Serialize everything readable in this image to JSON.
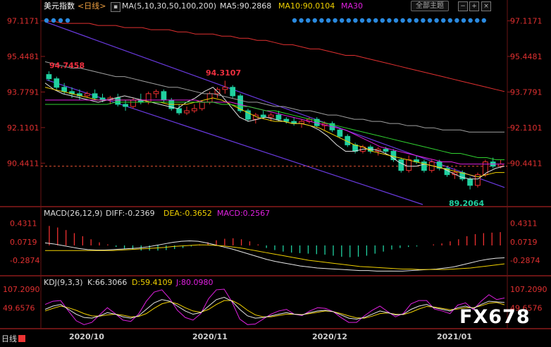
{
  "header": {
    "main_title": "美元指数",
    "period": "<日线>",
    "ma_set": "MA(5,10,30,50,100,200)",
    "ma5": "MA5:90.2868",
    "ma10": "MA10:90.0104",
    "ma30": "MA30",
    "theme_button": "全部主题",
    "colors": {
      "ma5": "#e0e0e0",
      "ma10": "#f0d000",
      "ma30": "#e020e0",
      "ma50": "#30d030",
      "ma100": "#a0a0a0",
      "ma200": "#e03030"
    }
  },
  "chart_data": [
    {
      "type": "line",
      "panel": "candlestick",
      "title": "美元指数 <日线>",
      "ylim": [
        88.5,
        97.5
      ],
      "y_ticks": [
        "97.1171",
        "95.4481",
        "93.7791",
        "92.1101",
        "90.4411"
      ],
      "x_ticks": [
        "2020/10",
        "2020/11",
        "2020/12",
        "2021/01"
      ],
      "annotations": [
        "94.7458",
        "94.3107",
        "89.2064"
      ],
      "current_level": 90.3,
      "series": [
        {
          "name": "MA5:90.2868",
          "values": [
            94.2,
            93.9,
            93.7,
            93.6,
            93.5,
            93.4,
            93.3,
            93.4,
            93.5,
            93.6,
            93.5,
            93.4,
            93.3,
            93.2,
            93.1,
            93.0,
            93.3,
            93.5,
            93.8,
            94.0,
            93.6,
            93.1,
            92.6,
            92.4,
            92.5,
            92.6,
            92.5,
            92.4,
            92.3,
            92.3,
            92.2,
            92.0,
            91.7,
            91.3,
            91.0,
            91.0,
            91.1,
            91.1,
            91.0,
            90.8,
            90.5,
            90.3,
            90.3,
            90.4,
            90.3,
            90.2,
            90.0,
            89.8,
            89.7,
            89.7,
            90.0,
            90.2,
            90.3
          ]
        },
        {
          "name": "MA10:90.0104",
          "values": [
            94.0,
            93.9,
            93.8,
            93.7,
            93.6,
            93.5,
            93.4,
            93.4,
            93.4,
            93.4,
            93.4,
            93.4,
            93.3,
            93.3,
            93.2,
            93.2,
            93.2,
            93.3,
            93.4,
            93.5,
            93.4,
            93.2,
            93.0,
            92.8,
            92.6,
            92.5,
            92.4,
            92.4,
            92.3,
            92.3,
            92.2,
            92.1,
            91.9,
            91.7,
            91.5,
            91.3,
            91.2,
            91.0,
            90.9,
            90.8,
            90.7,
            90.6,
            90.5,
            90.4,
            90.3,
            90.2,
            90.1,
            90.0,
            89.9,
            89.8,
            89.9,
            90.0,
            90.0
          ]
        },
        {
          "name": "MA30",
          "values": [
            93.4,
            93.4,
            93.4,
            93.4,
            93.4,
            93.4,
            93.4,
            93.4,
            93.4,
            93.4,
            93.4,
            93.4,
            93.4,
            93.4,
            93.4,
            93.4,
            93.4,
            93.4,
            93.3,
            93.3,
            93.3,
            93.3,
            93.2,
            93.1,
            93.0,
            92.9,
            92.8,
            92.7,
            92.6,
            92.5,
            92.4,
            92.3,
            92.2,
            92.1,
            92.0,
            91.8,
            91.6,
            91.4,
            91.2,
            91.1,
            91.0,
            90.9,
            90.8,
            90.7,
            90.6,
            90.5,
            90.5,
            90.4,
            90.4,
            90.4,
            90.4,
            90.4,
            90.4
          ]
        },
        {
          "name": "MA50",
          "values": [
            93.2,
            93.2,
            93.2,
            93.2,
            93.2,
            93.2,
            93.2,
            93.2,
            93.3,
            93.3,
            93.3,
            93.3,
            93.3,
            93.3,
            93.3,
            93.3,
            93.3,
            93.3,
            93.3,
            93.3,
            93.2,
            93.2,
            93.1,
            93.1,
            93.0,
            92.9,
            92.9,
            92.8,
            92.7,
            92.6,
            92.5,
            92.4,
            92.3,
            92.2,
            92.1,
            92.0,
            91.9,
            91.8,
            91.7,
            91.6,
            91.5,
            91.4,
            91.3,
            91.2,
            91.1,
            91.0,
            90.9,
            90.9,
            90.8,
            90.7,
            90.7,
            90.6,
            90.6
          ]
        },
        {
          "name": "MA100",
          "values": [
            95.2,
            95.1,
            95.0,
            94.9,
            94.9,
            94.8,
            94.7,
            94.6,
            94.5,
            94.5,
            94.4,
            94.3,
            94.2,
            94.1,
            94.0,
            94.0,
            93.9,
            93.8,
            93.7,
            93.7,
            93.6,
            93.5,
            93.4,
            93.3,
            93.3,
            93.2,
            93.1,
            93.1,
            93.0,
            92.9,
            92.9,
            92.8,
            92.7,
            92.7,
            92.6,
            92.5,
            92.5,
            92.4,
            92.4,
            92.3,
            92.3,
            92.2,
            92.2,
            92.1,
            92.1,
            92.0,
            92.0,
            92.0,
            91.9,
            91.9,
            91.9,
            91.9,
            91.9
          ]
        },
        {
          "name": "MA200",
          "values": [
            97.1,
            97.1,
            97.0,
            97.0,
            97.0,
            97.0,
            96.9,
            96.9,
            96.9,
            96.8,
            96.8,
            96.8,
            96.7,
            96.7,
            96.7,
            96.6,
            96.6,
            96.5,
            96.5,
            96.5,
            96.4,
            96.4,
            96.3,
            96.3,
            96.2,
            96.2,
            96.1,
            96.0,
            96.0,
            95.9,
            95.8,
            95.8,
            95.7,
            95.6,
            95.5,
            95.5,
            95.4,
            95.3,
            95.2,
            95.1,
            95.0,
            94.9,
            94.8,
            94.7,
            94.6,
            94.5,
            94.4,
            94.3,
            94.2,
            94.1,
            94.0,
            93.9,
            93.8
          ]
        }
      ],
      "candles": [
        [
          94.6,
          94.75,
          94.3,
          94.4
        ],
        [
          94.4,
          94.5,
          93.9,
          94.0
        ],
        [
          94.0,
          94.2,
          93.7,
          93.8
        ],
        [
          93.8,
          94.0,
          93.5,
          93.7
        ],
        [
          93.7,
          93.9,
          93.4,
          93.6
        ],
        [
          93.6,
          93.8,
          93.5,
          93.7
        ],
        [
          93.7,
          93.9,
          93.4,
          93.5
        ],
        [
          93.5,
          93.7,
          93.3,
          93.4
        ],
        [
          93.4,
          93.6,
          93.2,
          93.5
        ],
        [
          93.5,
          93.7,
          93.1,
          93.2
        ],
        [
          93.2,
          93.4,
          92.9,
          93.1
        ],
        [
          93.1,
          93.5,
          93.0,
          93.4
        ],
        [
          93.4,
          93.7,
          93.2,
          93.3
        ],
        [
          93.3,
          93.8,
          93.2,
          93.7
        ],
        [
          93.7,
          93.9,
          93.5,
          93.8
        ],
        [
          93.8,
          93.9,
          93.3,
          93.4
        ],
        [
          93.4,
          93.5,
          92.9,
          93.0
        ],
        [
          93.0,
          93.2,
          92.7,
          92.8
        ],
        [
          92.8,
          93.1,
          92.7,
          92.9
        ],
        [
          92.9,
          93.2,
          92.8,
          93.0
        ],
        [
          93.0,
          93.4,
          92.9,
          93.3
        ],
        [
          93.3,
          93.8,
          93.2,
          93.7
        ],
        [
          93.7,
          94.0,
          93.5,
          93.9
        ],
        [
          93.9,
          94.31,
          93.7,
          94.0
        ],
        [
          94.0,
          94.1,
          93.5,
          93.6
        ],
        [
          93.6,
          93.7,
          92.8,
          92.9
        ],
        [
          92.9,
          93.0,
          92.4,
          92.5
        ],
        [
          92.5,
          92.8,
          92.3,
          92.7
        ],
        [
          92.7,
          92.9,
          92.5,
          92.6
        ],
        [
          92.6,
          92.8,
          92.4,
          92.7
        ],
        [
          92.7,
          92.9,
          92.4,
          92.5
        ],
        [
          92.5,
          92.6,
          92.3,
          92.4
        ],
        [
          92.4,
          92.6,
          92.2,
          92.3
        ],
        [
          92.3,
          92.5,
          92.1,
          92.4
        ],
        [
          92.4,
          92.6,
          92.3,
          92.5
        ],
        [
          92.5,
          92.6,
          92.1,
          92.2
        ],
        [
          92.2,
          92.4,
          92.0,
          92.3
        ],
        [
          92.3,
          92.4,
          91.9,
          92.0
        ],
        [
          92.0,
          92.1,
          91.6,
          91.7
        ],
        [
          91.7,
          91.8,
          91.2,
          91.3
        ],
        [
          91.3,
          91.4,
          90.9,
          91.0
        ],
        [
          91.0,
          91.3,
          90.9,
          91.2
        ],
        [
          91.2,
          91.3,
          90.9,
          91.0
        ],
        [
          91.0,
          91.2,
          90.8,
          91.1
        ],
        [
          91.1,
          91.2,
          90.9,
          91.0
        ],
        [
          91.0,
          91.1,
          90.5,
          90.6
        ],
        [
          90.6,
          90.7,
          90.0,
          90.1
        ],
        [
          90.1,
          90.8,
          90.0,
          90.6
        ],
        [
          90.6,
          90.8,
          90.4,
          90.5
        ],
        [
          90.5,
          90.6,
          90.0,
          90.1
        ],
        [
          90.1,
          90.6,
          90.0,
          90.5
        ],
        [
          90.5,
          90.6,
          90.1,
          90.2
        ],
        [
          90.2,
          90.3,
          89.8,
          89.9
        ],
        [
          89.9,
          90.2,
          89.7,
          90.0
        ],
        [
          90.0,
          90.1,
          89.6,
          89.7
        ],
        [
          89.7,
          89.8,
          89.21,
          89.4
        ],
        [
          89.4,
          90.0,
          89.3,
          89.9
        ],
        [
          89.9,
          90.6,
          89.8,
          90.5
        ],
        [
          90.5,
          90.7,
          90.2,
          90.3
        ],
        [
          90.3,
          90.6,
          90.2,
          90.4
        ]
      ]
    },
    {
      "type": "bar",
      "panel": "macd",
      "title": "MACD(26,12,9)",
      "legend": [
        "DIFF:-0.2369",
        "DEA:-0.3652",
        "MACD:0.2567"
      ],
      "y_ticks": [
        "0.4311",
        "0.0719",
        "-0.2874"
      ],
      "ylim": [
        -0.55,
        0.55
      ],
      "histogram": [
        0.38,
        0.35,
        0.3,
        0.24,
        0.18,
        0.12,
        0.06,
        0.02,
        -0.03,
        -0.06,
        -0.08,
        -0.1,
        -0.1,
        -0.1,
        -0.09,
        -0.07,
        -0.05,
        -0.02,
        0.02,
        0.06,
        0.1,
        0.13,
        0.14,
        0.12,
        0.08,
        0.02,
        -0.05,
        -0.09,
        -0.12,
        -0.14,
        -0.15,
        -0.16,
        -0.17,
        -0.18,
        -0.2,
        -0.22,
        -0.23,
        -0.22,
        -0.2,
        -0.16,
        -0.12,
        -0.08,
        -0.05,
        -0.03,
        -0.02,
        0.0,
        0.02,
        0.04,
        0.08,
        0.12,
        0.18,
        0.22,
        0.24,
        0.25,
        0.26
      ],
      "diff": [
        0.05,
        0.03,
        0.0,
        -0.03,
        -0.06,
        -0.08,
        -0.09,
        -0.09,
        -0.08,
        -0.07,
        -0.06,
        -0.05,
        -0.03,
        0.0,
        0.03,
        0.06,
        0.08,
        0.09,
        0.08,
        0.05,
        0.01,
        -0.03,
        -0.07,
        -0.12,
        -0.17,
        -0.22,
        -0.27,
        -0.31,
        -0.34,
        -0.37,
        -0.4,
        -0.42,
        -0.44,
        -0.45,
        -0.46,
        -0.47,
        -0.48,
        -0.49,
        -0.49,
        -0.5,
        -0.5,
        -0.5,
        -0.5,
        -0.49,
        -0.48,
        -0.47,
        -0.46,
        -0.44,
        -0.42,
        -0.38,
        -0.34,
        -0.3,
        -0.27,
        -0.25,
        -0.24
      ],
      "dea": [
        -0.1,
        -0.1,
        -0.1,
        -0.1,
        -0.1,
        -0.1,
        -0.1,
        -0.1,
        -0.1,
        -0.09,
        -0.08,
        -0.07,
        -0.06,
        -0.05,
        -0.04,
        -0.02,
        -0.01,
        0.0,
        0.01,
        0.01,
        0.0,
        -0.01,
        -0.03,
        -0.05,
        -0.08,
        -0.11,
        -0.14,
        -0.17,
        -0.2,
        -0.23,
        -0.26,
        -0.29,
        -0.31,
        -0.33,
        -0.35,
        -0.37,
        -0.39,
        -0.41,
        -0.42,
        -0.43,
        -0.44,
        -0.45,
        -0.46,
        -0.46,
        -0.47,
        -0.47,
        -0.47,
        -0.47,
        -0.46,
        -0.45,
        -0.44,
        -0.42,
        -0.4,
        -0.38,
        -0.36
      ]
    },
    {
      "type": "line",
      "panel": "kdj",
      "title": "KDJ(9,3,3)",
      "legend": [
        "K:66.3066",
        "D:59.4109",
        "J:80.0980"
      ],
      "y_ticks": [
        "107.2090",
        "49.6576"
      ],
      "ylim": [
        -10,
        120
      ],
      "k": [
        45,
        55,
        60,
        45,
        30,
        20,
        18,
        25,
        35,
        30,
        22,
        18,
        25,
        45,
        65,
        75,
        70,
        55,
        40,
        30,
        35,
        55,
        75,
        82,
        70,
        45,
        25,
        18,
        20,
        25,
        30,
        35,
        30,
        28,
        35,
        40,
        42,
        38,
        28,
        18,
        15,
        20,
        30,
        40,
        35,
        28,
        30,
        45,
        55,
        60,
        50,
        45,
        40,
        50,
        55,
        48,
        60,
        70,
        68,
        66
      ],
      "d": [
        40,
        48,
        55,
        50,
        42,
        32,
        25,
        24,
        28,
        30,
        27,
        22,
        23,
        32,
        48,
        62,
        68,
        62,
        50,
        40,
        36,
        45,
        60,
        72,
        72,
        60,
        42,
        28,
        22,
        22,
        26,
        30,
        30,
        29,
        32,
        36,
        40,
        38,
        32,
        25,
        19,
        18,
        24,
        32,
        34,
        30,
        29,
        36,
        46,
        54,
        52,
        48,
        44,
        46,
        50,
        50,
        56,
        64,
        66,
        59
      ],
      "j": [
        60,
        70,
        72,
        40,
        10,
        -2,
        5,
        28,
        50,
        32,
        12,
        8,
        30,
        70,
        98,
        105,
        78,
        42,
        20,
        12,
        32,
        78,
        105,
        107,
        68,
        15,
        -2,
        0,
        15,
        30,
        40,
        45,
        30,
        26,
        40,
        50,
        48,
        38,
        20,
        5,
        5,
        25,
        42,
        55,
        38,
        22,
        32,
        62,
        72,
        72,
        46,
        40,
        32,
        58,
        65,
        44,
        70,
        90,
        75,
        80
      ]
    }
  ],
  "footer": {
    "day_label": "日线",
    "watermark": "FX678"
  }
}
